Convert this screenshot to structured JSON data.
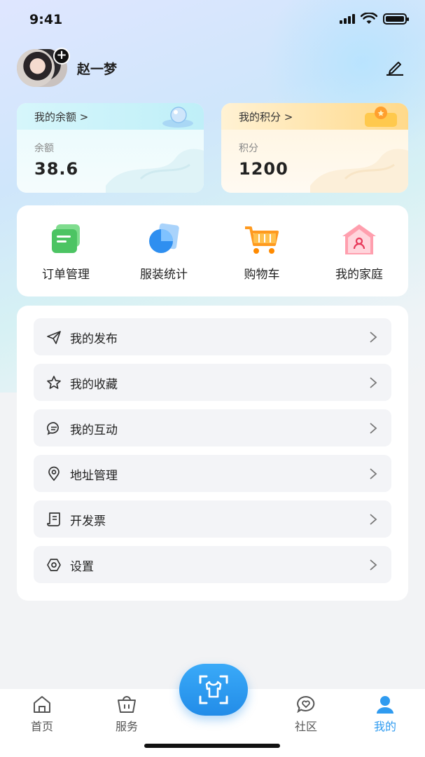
{
  "status_bar": {
    "time": "9:41"
  },
  "profile": {
    "username": "赵一梦"
  },
  "balance_card": {
    "title": "我的余额 >",
    "label": "余额",
    "value": "38.6"
  },
  "points_card": {
    "title": "我的积分 >",
    "label": "积分",
    "value": "1200"
  },
  "quick_actions": [
    {
      "label": "订单管理",
      "icon": "order-icon"
    },
    {
      "label": "服装统计",
      "icon": "stats-icon"
    },
    {
      "label": "购物车",
      "icon": "cart-icon"
    },
    {
      "label": "我的家庭",
      "icon": "family-icon"
    }
  ],
  "menu": [
    {
      "label": "我的发布",
      "icon": "send-icon"
    },
    {
      "label": "我的收藏",
      "icon": "star-icon"
    },
    {
      "label": "我的互动",
      "icon": "chat-icon"
    },
    {
      "label": "地址管理",
      "icon": "location-icon"
    },
    {
      "label": "开发票",
      "icon": "invoice-icon"
    },
    {
      "label": "设置",
      "icon": "gear-icon"
    }
  ],
  "tabbar": {
    "items": [
      {
        "label": "首页",
        "icon": "home-icon"
      },
      {
        "label": "服务",
        "icon": "service-icon"
      },
      {
        "label": "社区",
        "icon": "community-icon"
      },
      {
        "label": "我的",
        "icon": "profile-icon"
      }
    ],
    "active": "我的"
  },
  "colors": {
    "accent": "#2f9bf0",
    "background": "#f2f3f5"
  }
}
